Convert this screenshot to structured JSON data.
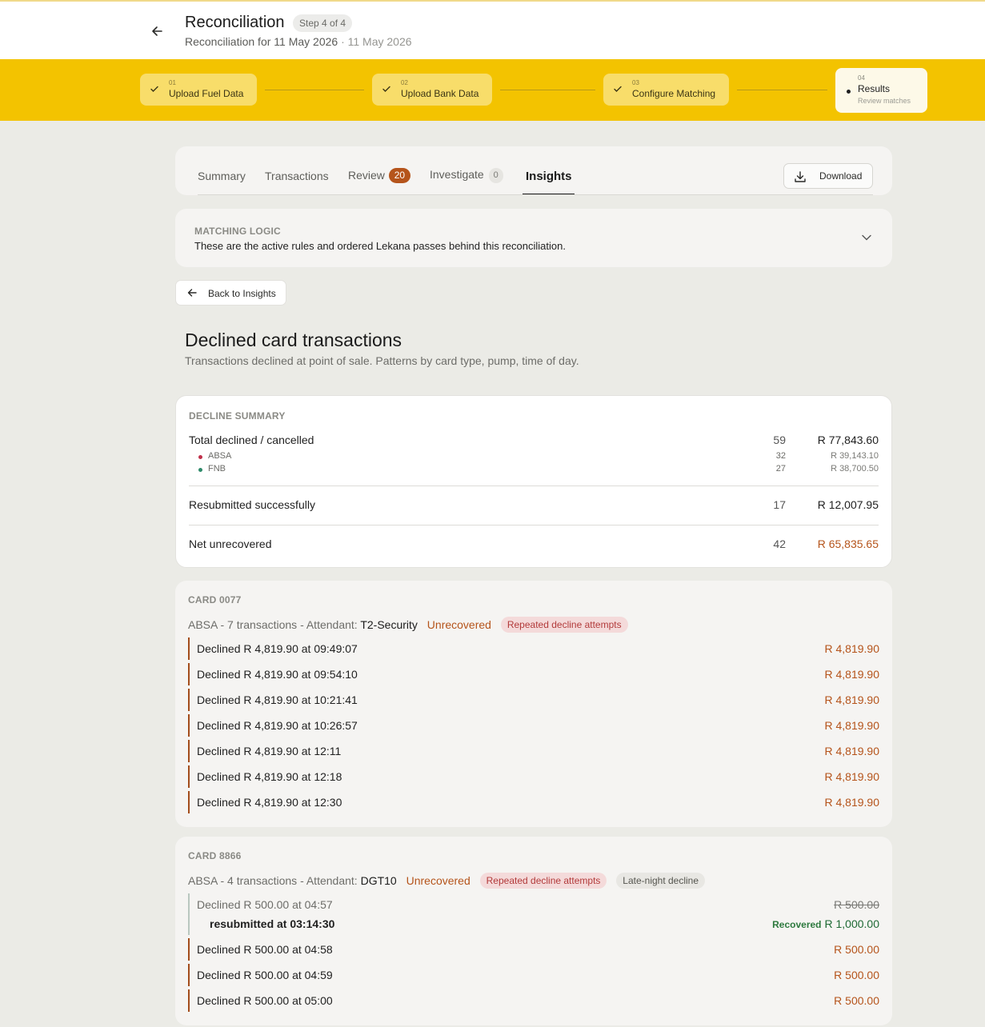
{
  "header": {
    "title": "Reconciliation",
    "step_pill": "Step 4 of 4",
    "subtitle": "Reconciliation for 11 May 2026",
    "subtitle_date": "· 11 May 2026"
  },
  "stepper": {
    "steps": [
      {
        "num": "01",
        "label": "Upload Fuel Data"
      },
      {
        "num": "02",
        "label": "Upload Bank Data"
      },
      {
        "num": "03",
        "label": "Configure Matching"
      },
      {
        "num": "04",
        "label": "Results",
        "sub": "Review matches"
      }
    ]
  },
  "tabs": {
    "summary": "Summary",
    "transactions": "Transactions",
    "review": "Review",
    "review_count": "20",
    "investigate": "Investigate",
    "investigate_count": "0",
    "insights": "Insights",
    "download": "Download"
  },
  "matching_logic": {
    "kicker": "MATCHING LOGIC",
    "description": "These are the active rules and ordered Lekana passes behind this reconciliation."
  },
  "back_button": "Back to Insights",
  "page": {
    "title": "Declined card transactions",
    "subtitle": "Transactions declined at point of sale. Patterns by card type, pump, time of day."
  },
  "decline_summary": {
    "kicker": "DECLINE SUMMARY",
    "total": {
      "label": "Total declined / cancelled",
      "count": "59",
      "amount": "R 77,843.60"
    },
    "banks": [
      {
        "name": "ABSA",
        "count": "32",
        "amount": "R 39,143.10",
        "color": "#c0304a"
      },
      {
        "name": "FNB",
        "count": "27",
        "amount": "R 38,700.50",
        "color": "#2e8a6a"
      }
    ],
    "resubmitted": {
      "label": "Resubmitted successfully",
      "count": "17",
      "amount": "R 12,007.95"
    },
    "net": {
      "label": "Net unrecovered",
      "count": "42",
      "amount": "R 65,835.65"
    }
  },
  "cards": [
    {
      "kicker": "CARD 0077",
      "meta_prefix": "ABSA - 7 transactions - Attendant:",
      "attendant": "T2-Security",
      "status": "Unrecovered",
      "tags": [
        "Repeated decline attempts"
      ],
      "transactions": [
        {
          "text": "Declined R 4,819.90 at 09:49:07",
          "amount": "R 4,819.90"
        },
        {
          "text": "Declined R 4,819.90 at 09:54:10",
          "amount": "R 4,819.90"
        },
        {
          "text": "Declined R 4,819.90 at 10:21:41",
          "amount": "R 4,819.90"
        },
        {
          "text": "Declined R 4,819.90 at 10:26:57",
          "amount": "R 4,819.90"
        },
        {
          "text": "Declined R 4,819.90 at 12:11",
          "amount": "R 4,819.90"
        },
        {
          "text": "Declined R 4,819.90 at 12:18",
          "amount": "R 4,819.90"
        },
        {
          "text": "Declined R 4,819.90 at 12:30",
          "amount": "R 4,819.90"
        }
      ]
    },
    {
      "kicker": "CARD 8866",
      "meta_prefix": "ABSA - 4 transactions - Attendant:",
      "attendant": "DGT10",
      "status": "Unrecovered",
      "tags": [
        "Repeated decline attempts",
        "Late-night decline"
      ],
      "recovered": {
        "text": "Declined R 500.00 at 04:57",
        "original_amount": "R 500.00",
        "resubmitted": "resubmitted at 03:14:30",
        "recovered_label": "Recovered",
        "recovered_amount": "R 1,000.00"
      },
      "transactions": [
        {
          "text": "Declined R 500.00 at 04:58",
          "amount": "R 500.00"
        },
        {
          "text": "Declined R 500.00 at 04:59",
          "amount": "R 500.00"
        },
        {
          "text": "Declined R 500.00 at 05:00",
          "amount": "R 500.00"
        }
      ]
    }
  ]
}
